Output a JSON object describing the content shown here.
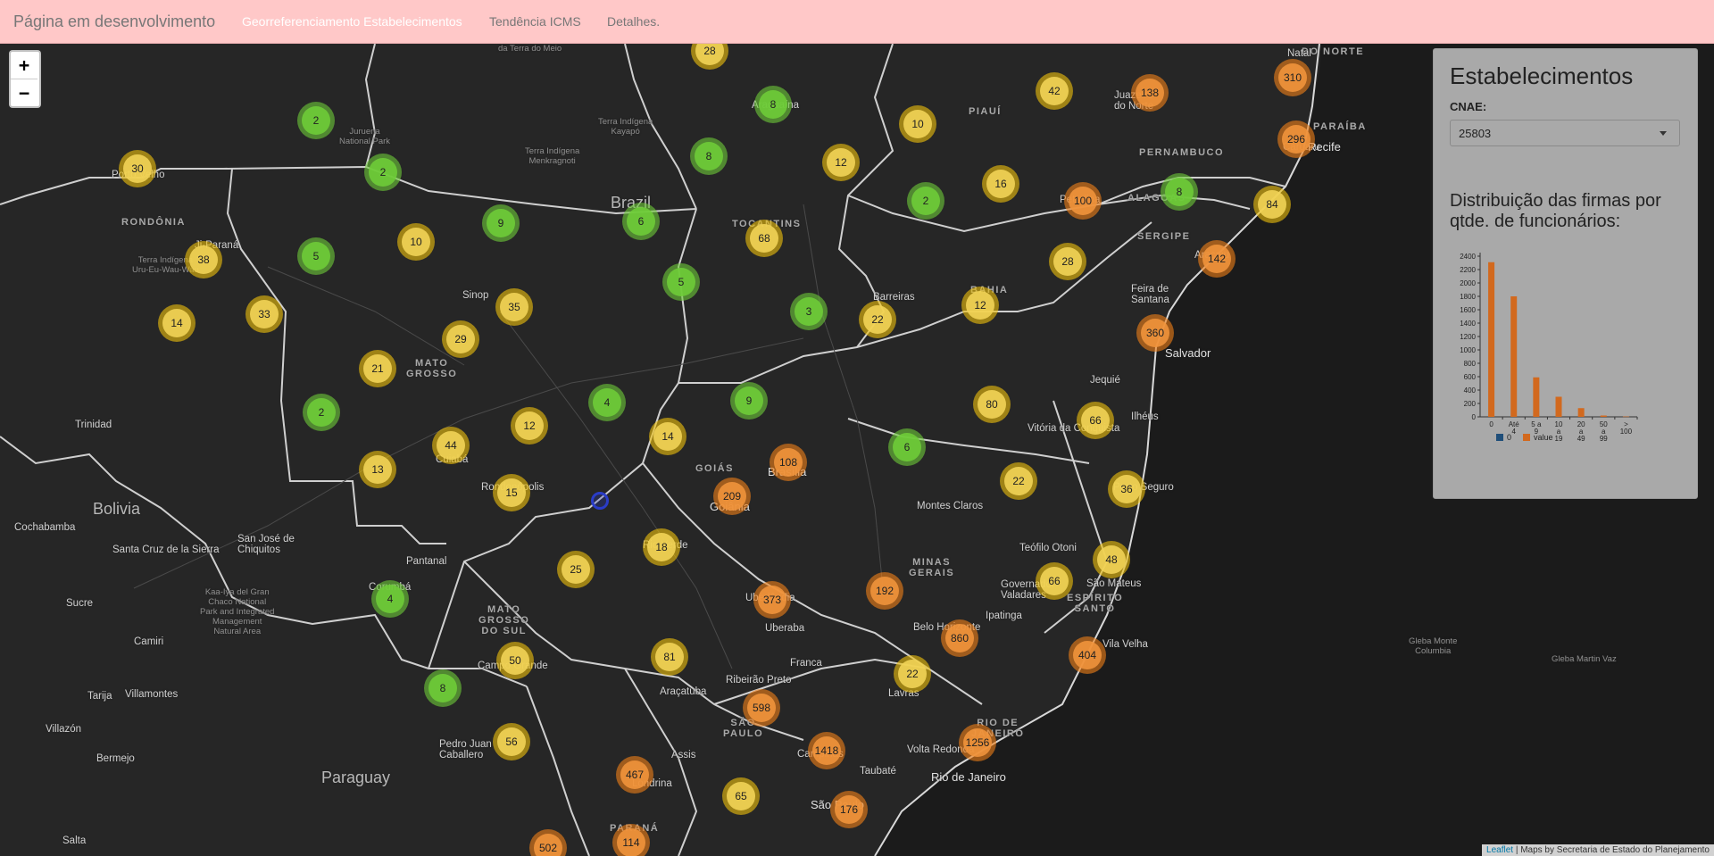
{
  "navbar": {
    "brand": "Página em desenvolvimento",
    "links": [
      "Georreferenciamento Estabelecimentos",
      "Tendência ICMS",
      "Detalhes."
    ]
  },
  "zoom": {
    "in": "+",
    "out": "−"
  },
  "panel": {
    "title": "Estabelecimentos",
    "cnae_label": "CNAE:",
    "cnae_value": "25803",
    "chart_title": "Distribuição das firmas por qtde. de funcionários:"
  },
  "attribution": {
    "link": "Leaflet",
    "text": "| Maps by Secretaria de Estado do Planejamento"
  },
  "map": {
    "places": [
      {
        "name": "da Terra do Meio",
        "cls": "small"
      },
      {
        "name": "DO NORTE",
        "cls": "state"
      },
      {
        "name": "Natal",
        "cls": "city"
      },
      {
        "name": "Terra Indígena\nKayapó",
        "cls": "small"
      },
      {
        "name": "Terra Indígena\nMenkragnoti",
        "cls": "small"
      },
      {
        "name": "Juruena\nNational Park",
        "cls": "small"
      },
      {
        "name": "PIAUÍ",
        "cls": "state"
      },
      {
        "name": "PARAÍBA",
        "cls": "state"
      },
      {
        "name": "Juazeiro\ndo Norte",
        "cls": "city"
      },
      {
        "name": "Caruaru",
        "cls": "city"
      },
      {
        "name": "Recife",
        "cls": "big"
      },
      {
        "name": "PERNAMBUCO",
        "cls": "state"
      },
      {
        "name": "ALAGOAS",
        "cls": "state"
      },
      {
        "name": "Araguaína",
        "cls": "city"
      },
      {
        "name": "Porto Velho",
        "cls": "city"
      },
      {
        "name": "RONDÔNIA",
        "cls": "state"
      },
      {
        "name": "Ji-Paraná",
        "cls": "city"
      },
      {
        "name": "Terra Indígena\nUru-Eu-Wau-Wau",
        "cls": "small"
      },
      {
        "name": "Brazil",
        "cls": "country"
      },
      {
        "name": "TOCANTINS",
        "cls": "state"
      },
      {
        "name": "Petrolina",
        "cls": "city"
      },
      {
        "name": "SERGIPE",
        "cls": "state"
      },
      {
        "name": "Aracaju",
        "cls": "city"
      },
      {
        "name": "BAHIA",
        "cls": "state"
      },
      {
        "name": "Barreiras",
        "cls": "city"
      },
      {
        "name": "Feira de\nSantana",
        "cls": "city"
      },
      {
        "name": "Sinop",
        "cls": "city"
      },
      {
        "name": "MATO\nGROSSO",
        "cls": "state"
      },
      {
        "name": "Salvador",
        "cls": "big"
      },
      {
        "name": "Jequié",
        "cls": "city"
      },
      {
        "name": "Ilhéus",
        "cls": "city"
      },
      {
        "name": "Trinidad",
        "cls": "city"
      },
      {
        "name": "Vitória da Conquista",
        "cls": "city"
      },
      {
        "name": "Cuiabá",
        "cls": "city"
      },
      {
        "name": "Rondonópolis",
        "cls": "city"
      },
      {
        "name": "GOIÁS",
        "cls": "state"
      },
      {
        "name": "Brasília",
        "cls": "big"
      },
      {
        "name": "Goiânia",
        "cls": "big"
      },
      {
        "name": "Porto Seguro",
        "cls": "city"
      },
      {
        "name": "Bolivia",
        "cls": "country"
      },
      {
        "name": "Montes Claros",
        "cls": "city"
      },
      {
        "name": "Cochabamba",
        "cls": "city"
      },
      {
        "name": "Santa Cruz de la Sierra",
        "cls": "city"
      },
      {
        "name": "San José de\nChiquitos",
        "cls": "city"
      },
      {
        "name": "Rio Verde",
        "cls": "city"
      },
      {
        "name": "Teófilo Otoni",
        "cls": "city"
      },
      {
        "name": "Pantanal",
        "cls": "city"
      },
      {
        "name": "MINAS\nGERAIS",
        "cls": "state"
      },
      {
        "name": "Governador\nValadares",
        "cls": "city"
      },
      {
        "name": "São Mateus",
        "cls": "city"
      },
      {
        "name": "ESPÍRITO\nSANTO",
        "cls": "state"
      },
      {
        "name": "Corumbá",
        "cls": "city"
      },
      {
        "name": "Kaa-Iya del Gran\nChaco National\nPark and Integrated\nManagement\nNatural Area",
        "cls": "small"
      },
      {
        "name": "Sucre",
        "cls": "city"
      },
      {
        "name": "MATO\nGROSSO\nDO SUL",
        "cls": "state"
      },
      {
        "name": "Uberlândia",
        "cls": "city"
      },
      {
        "name": "Ipatinga",
        "cls": "city"
      },
      {
        "name": "Uberaba",
        "cls": "city"
      },
      {
        "name": "Belo Horizonte",
        "cls": "city"
      },
      {
        "name": "Camiri",
        "cls": "city"
      },
      {
        "name": "Campo Grande",
        "cls": "city"
      },
      {
        "name": "Vila Velha",
        "cls": "city"
      },
      {
        "name": "Gleba Monte\nColumbia",
        "cls": "small"
      },
      {
        "name": "Gleba Martin Vaz",
        "cls": "small"
      },
      {
        "name": "Franca",
        "cls": "city"
      },
      {
        "name": "Araçatuba",
        "cls": "city"
      },
      {
        "name": "Ribeirão Preto",
        "cls": "city"
      },
      {
        "name": "Lavras",
        "cls": "city"
      },
      {
        "name": "Tarija",
        "cls": "city"
      },
      {
        "name": "Villamontes",
        "cls": "city"
      },
      {
        "name": "SÃO\nPAULO",
        "cls": "state"
      },
      {
        "name": "RIO DE\nJANEIRO",
        "cls": "state"
      },
      {
        "name": "Villazón",
        "cls": "city"
      },
      {
        "name": "Pedro Juan\nCaballero",
        "cls": "city"
      },
      {
        "name": "Bermejo",
        "cls": "city"
      },
      {
        "name": "Assis",
        "cls": "city"
      },
      {
        "name": "Campinas",
        "cls": "city"
      },
      {
        "name": "Volta Redonda",
        "cls": "city"
      },
      {
        "name": "Taubaté",
        "cls": "city"
      },
      {
        "name": "Paraguay",
        "cls": "country"
      },
      {
        "name": "Rio de Janeiro",
        "cls": "big"
      },
      {
        "name": "Londrina",
        "cls": "city"
      },
      {
        "name": "São Paulo",
        "cls": "big"
      },
      {
        "name": "Salta",
        "cls": "city"
      },
      {
        "name": "PARANÁ",
        "cls": "state"
      }
    ],
    "clusters": [
      {
        "n": "28",
        "c": "yellow"
      },
      {
        "n": "138",
        "c": "orange"
      },
      {
        "n": "310",
        "c": "orange"
      },
      {
        "n": "42",
        "c": "yellow"
      },
      {
        "n": "8",
        "c": "green"
      },
      {
        "n": "2",
        "c": "green"
      },
      {
        "n": "10",
        "c": "yellow"
      },
      {
        "n": "296",
        "c": "orange"
      },
      {
        "n": "30",
        "c": "yellow"
      },
      {
        "n": "2",
        "c": "green"
      },
      {
        "n": "8",
        "c": "green"
      },
      {
        "n": "12",
        "c": "yellow"
      },
      {
        "n": "16",
        "c": "yellow"
      },
      {
        "n": "100",
        "c": "orange"
      },
      {
        "n": "8",
        "c": "green"
      },
      {
        "n": "84",
        "c": "yellow"
      },
      {
        "n": "2",
        "c": "green"
      },
      {
        "n": "9",
        "c": "green"
      },
      {
        "n": "6",
        "c": "green"
      },
      {
        "n": "10",
        "c": "yellow"
      },
      {
        "n": "68",
        "c": "yellow"
      },
      {
        "n": "38",
        "c": "yellow"
      },
      {
        "n": "5",
        "c": "green"
      },
      {
        "n": "142",
        "c": "orange"
      },
      {
        "n": "28",
        "c": "yellow"
      },
      {
        "n": "5",
        "c": "green"
      },
      {
        "n": "35",
        "c": "yellow"
      },
      {
        "n": "3",
        "c": "green"
      },
      {
        "n": "22",
        "c": "yellow"
      },
      {
        "n": "12",
        "c": "yellow"
      },
      {
        "n": "14",
        "c": "yellow"
      },
      {
        "n": "33",
        "c": "yellow"
      },
      {
        "n": "29",
        "c": "yellow"
      },
      {
        "n": "360",
        "c": "orange"
      },
      {
        "n": "21",
        "c": "yellow"
      },
      {
        "n": "4",
        "c": "green"
      },
      {
        "n": "9",
        "c": "green"
      },
      {
        "n": "80",
        "c": "yellow"
      },
      {
        "n": "2",
        "c": "green"
      },
      {
        "n": "12",
        "c": "yellow"
      },
      {
        "n": "44",
        "c": "yellow"
      },
      {
        "n": "14",
        "c": "yellow"
      },
      {
        "n": "66",
        "c": "yellow"
      },
      {
        "n": "108",
        "c": "orange"
      },
      {
        "n": "6",
        "c": "green"
      },
      {
        "n": "13",
        "c": "yellow"
      },
      {
        "n": "22",
        "c": "yellow"
      },
      {
        "n": "15",
        "c": "yellow"
      },
      {
        "n": "209",
        "c": "orange"
      },
      {
        "n": "36",
        "c": "yellow"
      },
      {
        "n": "18",
        "c": "yellow"
      },
      {
        "n": "25",
        "c": "yellow"
      },
      {
        "n": "48",
        "c": "yellow"
      },
      {
        "n": "66",
        "c": "yellow"
      },
      {
        "n": "192",
        "c": "orange"
      },
      {
        "n": "4",
        "c": "green"
      },
      {
        "n": "373",
        "c": "orange"
      },
      {
        "n": "860",
        "c": "orange"
      },
      {
        "n": "81",
        "c": "yellow"
      },
      {
        "n": "50",
        "c": "yellow"
      },
      {
        "n": "404",
        "c": "orange"
      },
      {
        "n": "8",
        "c": "green"
      },
      {
        "n": "22",
        "c": "yellow"
      },
      {
        "n": "598",
        "c": "orange"
      },
      {
        "n": "56",
        "c": "yellow"
      },
      {
        "n": "1256",
        "c": "orange"
      },
      {
        "n": "1418",
        "c": "orange"
      },
      {
        "n": "467",
        "c": "orange"
      },
      {
        "n": "65",
        "c": "yellow"
      },
      {
        "n": "176",
        "c": "orange"
      },
      {
        "n": "502",
        "c": "orange"
      },
      {
        "n": "114",
        "c": "orange"
      }
    ]
  },
  "chart_data": {
    "type": "bar",
    "categories": [
      "0",
      "Até\n4",
      "5 a\n9",
      "10\na\n19",
      "20\na\n49",
      "50\na\n99",
      ">\n100"
    ],
    "series": [
      {
        "name": "0",
        "values": [
          0,
          0,
          0,
          0,
          0,
          0,
          0
        ]
      },
      {
        "name": "value",
        "values": [
          2310,
          1800,
          590,
          300,
          130,
          20,
          5
        ]
      }
    ],
    "yticks": [
      0,
      200,
      400,
      600,
      800,
      1000,
      1200,
      1400,
      1600,
      1800,
      2000,
      2200,
      2400
    ],
    "ylim": [
      0,
      2400
    ],
    "colors": {
      "0": "#1f4e79",
      "value": "#d2691e"
    },
    "legend": "bottom"
  }
}
